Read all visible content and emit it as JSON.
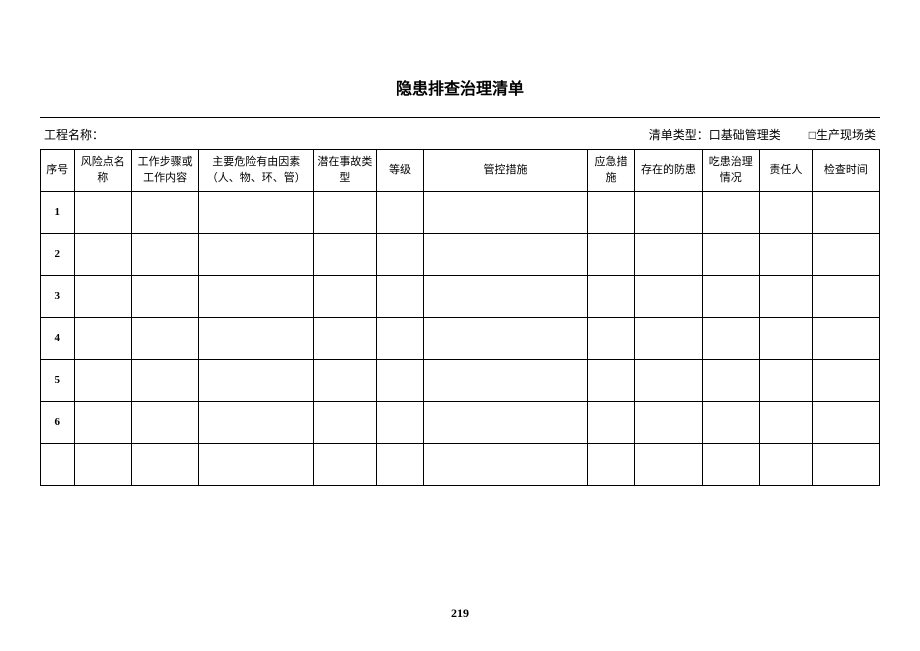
{
  "title": "隐患排查治理清单",
  "meta": {
    "project_label": "工程名称：",
    "type_label": "清单类型：",
    "type_option1": "口基础管理类",
    "type_option2": "□生产现场类"
  },
  "headers": {
    "seq": "序号",
    "risk": "风险点名称",
    "step": "工作步骤或工作内容",
    "factor": "主要危险有由因素（人、物、环、管）",
    "accident": "潜在事故类型",
    "level": "等级",
    "measure": "管控措施",
    "emergency": "应急措施",
    "exist": "存在的防患",
    "treat": "吃患治理情况",
    "resp": "责任人",
    "time": "检查时间"
  },
  "rows": [
    {
      "seq": "1"
    },
    {
      "seq": "2"
    },
    {
      "seq": "3"
    },
    {
      "seq": "4"
    },
    {
      "seq": "5"
    },
    {
      "seq": "6"
    },
    {
      "seq": ""
    }
  ],
  "page_number": "219"
}
